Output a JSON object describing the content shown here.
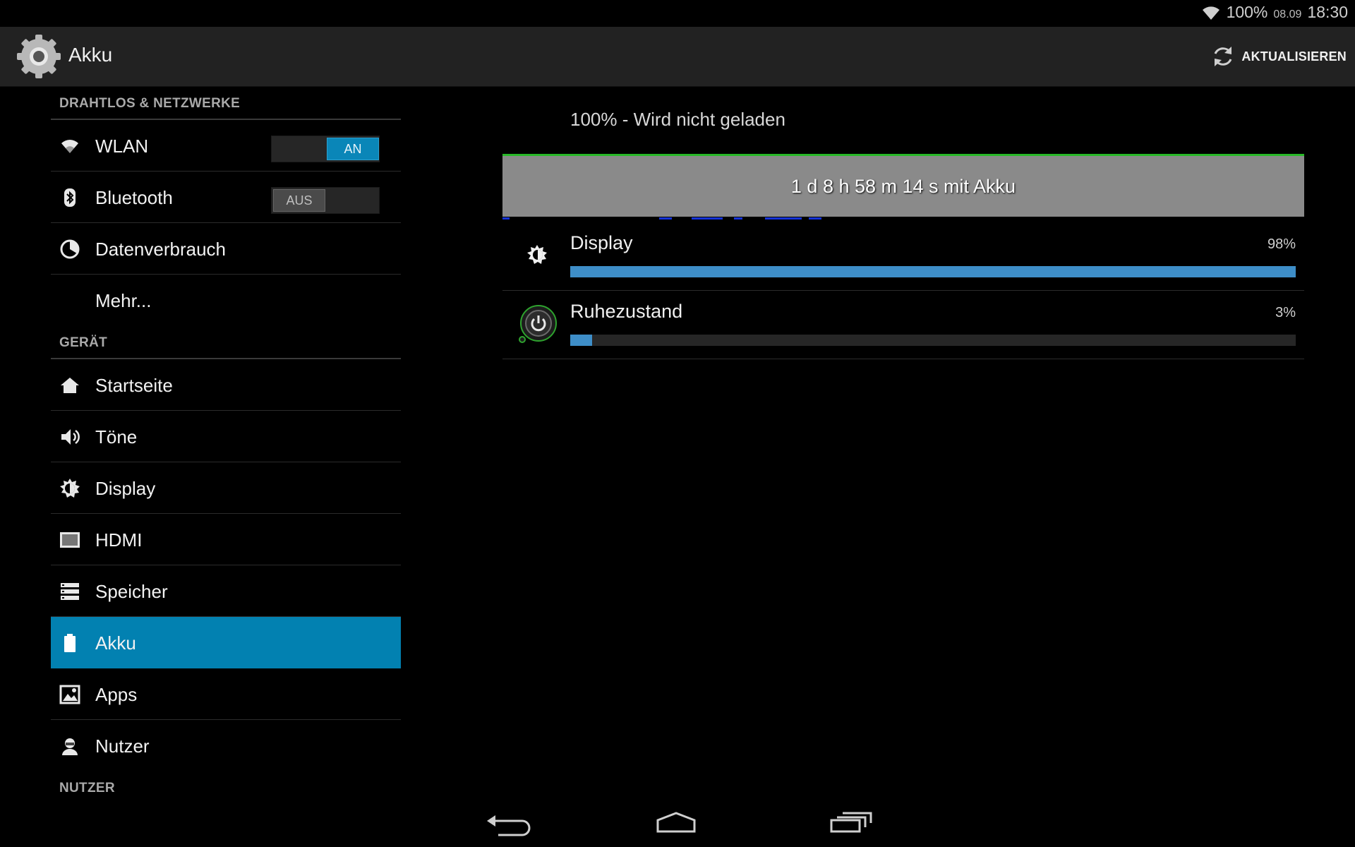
{
  "status_bar": {
    "battery": "100%",
    "date": "08.09",
    "time": "18:30",
    "wifi_icon": "wifi-icon"
  },
  "action_bar": {
    "title": "Akku",
    "app_icon": "settings-gear-icon",
    "refresh_label": "AKTUALISIEREN",
    "refresh_icon": "refresh-icon"
  },
  "sidebar": {
    "sections": [
      {
        "title": "DRAHTLOS & NETZWERKE"
      },
      {
        "title": "GERÄT"
      },
      {
        "title": "NUTZER"
      }
    ],
    "wireless_items": [
      {
        "label": "WLAN",
        "icon": "wifi-icon",
        "toggle": "AN",
        "toggle_state": "on"
      },
      {
        "label": "Bluetooth",
        "icon": "bluetooth-icon",
        "toggle": "AUS",
        "toggle_state": "off"
      },
      {
        "label": "Datenverbrauch",
        "icon": "data-usage-icon"
      },
      {
        "label": "Mehr..."
      }
    ],
    "device_items": [
      {
        "label": "Startseite",
        "icon": "home-icon"
      },
      {
        "label": "Töne",
        "icon": "speaker-icon"
      },
      {
        "label": "Display",
        "icon": "brightness-icon"
      },
      {
        "label": "HDMI",
        "icon": "hdmi-icon"
      },
      {
        "label": "Speicher",
        "icon": "storage-icon"
      },
      {
        "label": "Akku",
        "icon": "battery-icon",
        "selected": true
      },
      {
        "label": "Apps",
        "icon": "apps-icon"
      },
      {
        "label": "Nutzer",
        "icon": "user-icon"
      }
    ]
  },
  "battery": {
    "status": "100% - Wird nicht geladen",
    "graph_label": "1 d 8 h 58 m 14 s mit Akku",
    "usage": [
      {
        "name": "Display",
        "percent": "98%",
        "fraction": 1.0,
        "icon": "brightness-icon"
      },
      {
        "name": "Ruhezustand",
        "percent": "3%",
        "fraction": 0.03,
        "icon": "power-icon"
      }
    ]
  },
  "nav_bar": {
    "back_icon": "back-icon",
    "home_icon": "home-nav-icon",
    "recents_icon": "recent-apps-icon"
  },
  "colors": {
    "accent": "#0281b1",
    "bar_fill": "#3e8ec8",
    "graph_bg": "#8a8a8a",
    "graph_line": "#28b928"
  }
}
